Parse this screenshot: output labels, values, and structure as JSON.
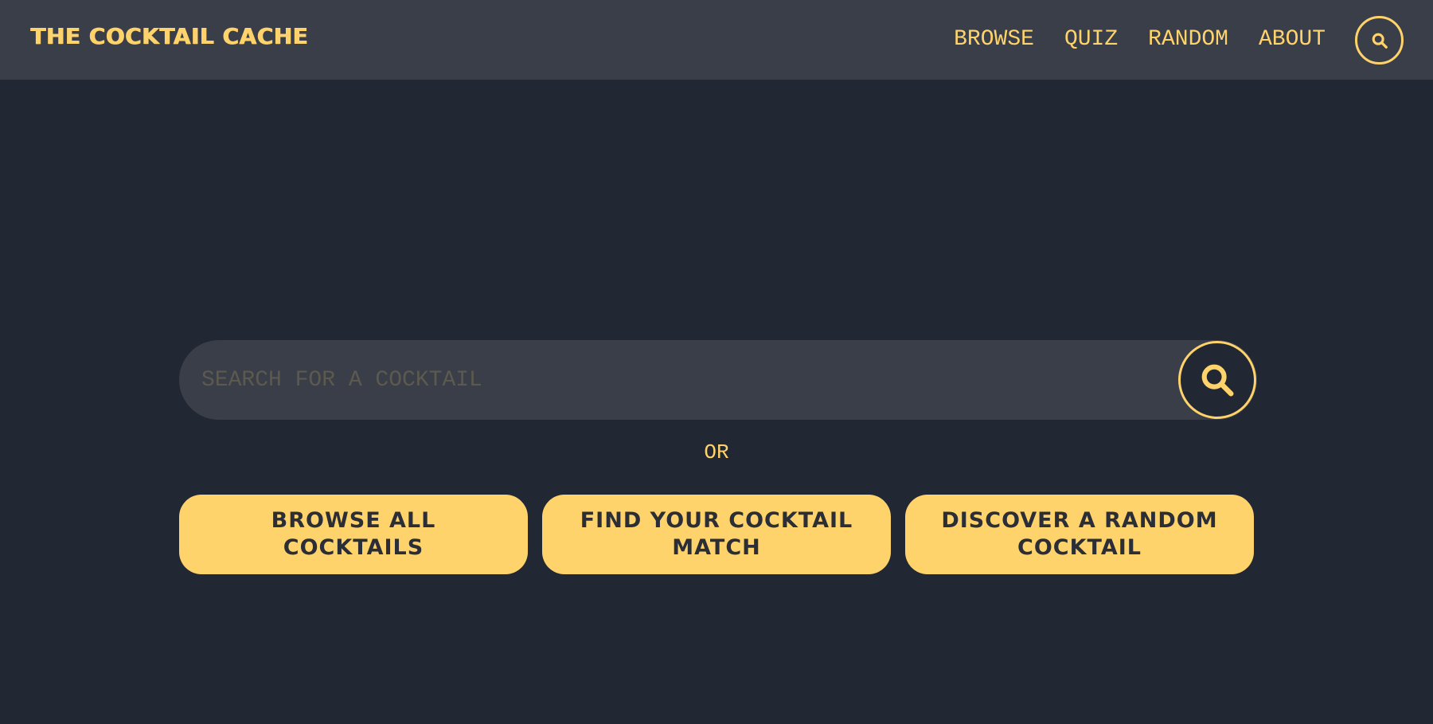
{
  "header": {
    "brand": "THE COCKTAIL CACHE",
    "nav": [
      {
        "label": "BROWSE"
      },
      {
        "label": "QUIZ"
      },
      {
        "label": "RANDOM"
      },
      {
        "label": "ABOUT"
      }
    ],
    "search_icon": "search-icon"
  },
  "search": {
    "placeholder": "SEARCH FOR A COCKTAIL",
    "value": "",
    "button_icon": "search-icon"
  },
  "divider_text": "OR",
  "actions": [
    {
      "label": "BROWSE ALL COCKTAILS"
    },
    {
      "label": "FIND YOUR COCKTAIL MATCH"
    },
    {
      "label": "DISCOVER A RANDOM COCKTAIL"
    }
  ],
  "colors": {
    "background": "#222833",
    "header_bg": "#3a3e48",
    "accent": "#ffd36b",
    "button_text": "#2b2e36",
    "placeholder": "#5c5a4e"
  }
}
